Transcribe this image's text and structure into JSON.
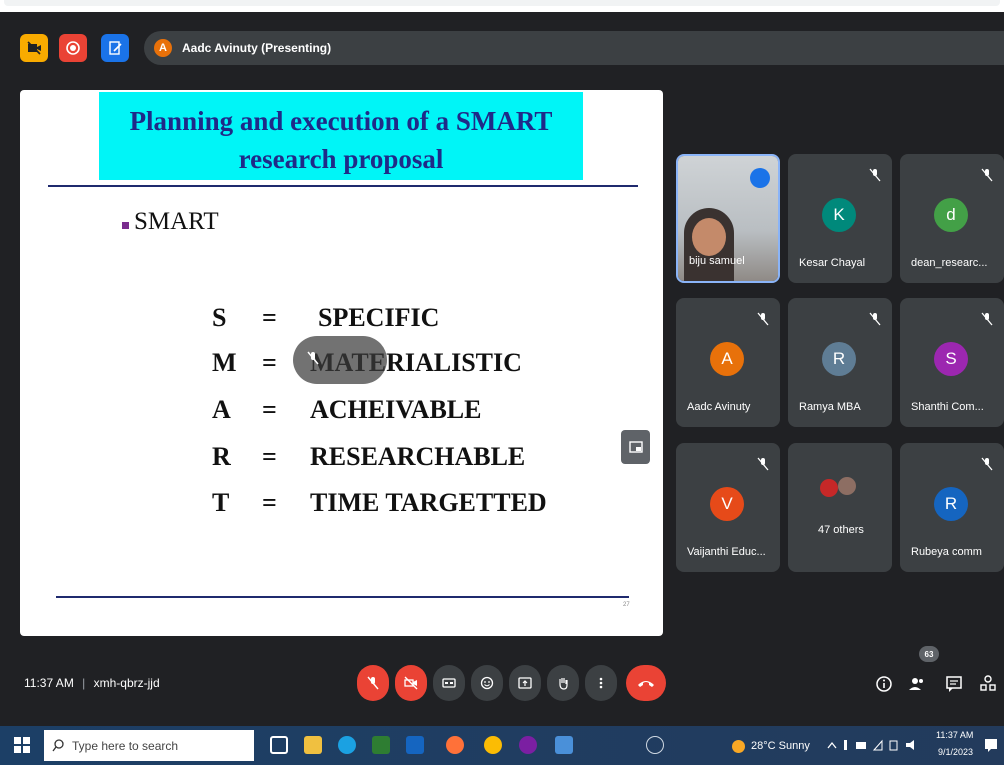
{
  "top": {
    "presenting_initial": "A",
    "presenting_label": "Aadc Avinuty (Presenting)"
  },
  "slide": {
    "title": "Planning and execution of a SMART research proposal",
    "bullet": "SMART",
    "rows": [
      {
        "letter": "S",
        "eq": "=",
        "word": "SPECIFIC"
      },
      {
        "letter": "M",
        "eq": "=",
        "word": "MATERIALISTIC"
      },
      {
        "letter": "A",
        "eq": "=",
        "word": "ACHEIVABLE"
      },
      {
        "letter": "R",
        "eq": "=",
        "word": "RESEARCHABLE"
      },
      {
        "letter": "T",
        "eq": "=",
        "word": "TIME TARGETTED"
      }
    ],
    "page_number": "27"
  },
  "participants": [
    {
      "name": "biju samuel",
      "initial": "",
      "color": "",
      "self": true
    },
    {
      "name": "Kesar Chayal",
      "initial": "K",
      "color": "#00897b"
    },
    {
      "name": "dean_researc...",
      "initial": "d",
      "color": "#43a047"
    },
    {
      "name": "Aadc Avinuty",
      "initial": "A",
      "color": "#e8710a"
    },
    {
      "name": "Ramya MBA",
      "initial": "R",
      "color": "#5f7d95"
    },
    {
      "name": "Shanthi Com...",
      "initial": "S",
      "color": "#9c27b0"
    },
    {
      "name": "Vaijanthi Educ...",
      "initial": "V",
      "color": "#e64a19"
    },
    {
      "name": "47 others",
      "initial": "",
      "color": ""
    },
    {
      "name": "Rubeya comm",
      "initial": "R",
      "color": "#1565c0"
    }
  ],
  "bottom": {
    "time": "11:37 AM",
    "separator": "|",
    "meeting_code": "xmh-qbrz-jjd",
    "people_count": "63"
  },
  "taskbar": {
    "search_placeholder": "Type here to search",
    "weather": "28°C  Sunny",
    "clock_time": "11:37 AM",
    "clock_date": "9/1/2023"
  }
}
